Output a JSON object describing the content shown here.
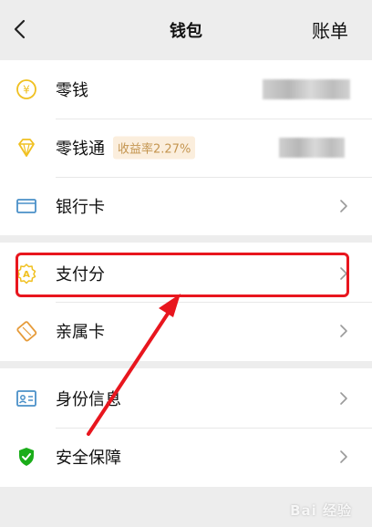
{
  "header": {
    "title": "钱包",
    "bill_label": "账单"
  },
  "groups": {
    "balance": {
      "change": {
        "label": "零钱",
        "icon": "yuan-coin-icon"
      },
      "lingqiantong": {
        "label": "零钱通",
        "badge": "收益率2.27%",
        "icon": "diamond-icon"
      },
      "bank_card": {
        "label": "银行卡",
        "icon": "bank-card-icon"
      }
    },
    "services": {
      "payment_score": {
        "label": "支付分",
        "icon": "payment-score-icon"
      },
      "family_card": {
        "label": "亲属卡",
        "icon": "family-card-icon"
      }
    },
    "security": {
      "identity": {
        "label": "身份信息",
        "icon": "id-card-icon"
      },
      "protection": {
        "label": "安全保障",
        "icon": "shield-check-icon"
      }
    }
  },
  "annotation": {
    "highlight_color": "#e8161e",
    "target": "支付分"
  },
  "watermark": "Bai 经验",
  "colors": {
    "accent_yellow": "#f0c020",
    "accent_blue": "#4a90c8",
    "accent_green": "#1aad19",
    "accent_orange": "#e69b3a",
    "badge_text": "#c49550",
    "badge_bg": "#fbeedd"
  }
}
